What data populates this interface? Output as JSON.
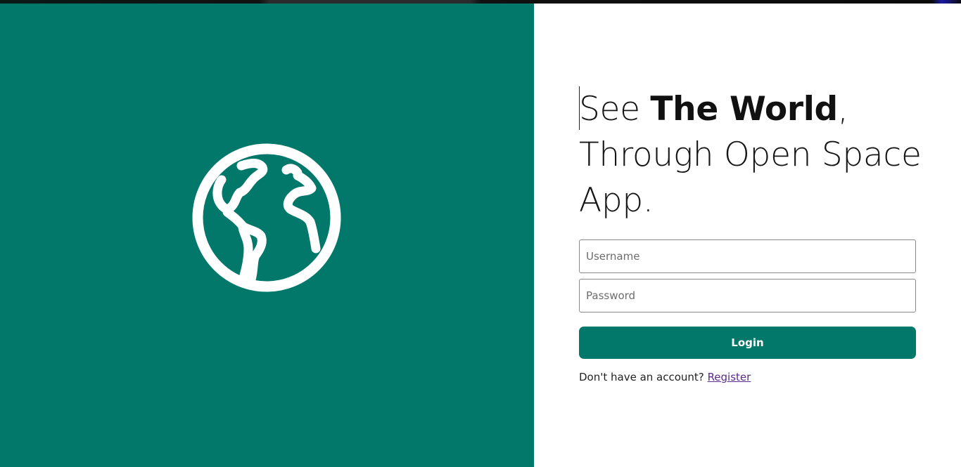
{
  "hero": {
    "icon": "globe-icon",
    "background_color": "#02786b"
  },
  "headline": {
    "prefix": "See ",
    "emphasis": "The World",
    "comma": ",",
    "line2": "Through Open Space",
    "line3": "App."
  },
  "form": {
    "username_placeholder": "Username",
    "password_placeholder": "Password",
    "login_label": "Login",
    "register_prompt": "Don't have an account?",
    "register_link": "Register"
  },
  "colors": {
    "accent": "#02786b",
    "link": "#5b2a8a"
  }
}
